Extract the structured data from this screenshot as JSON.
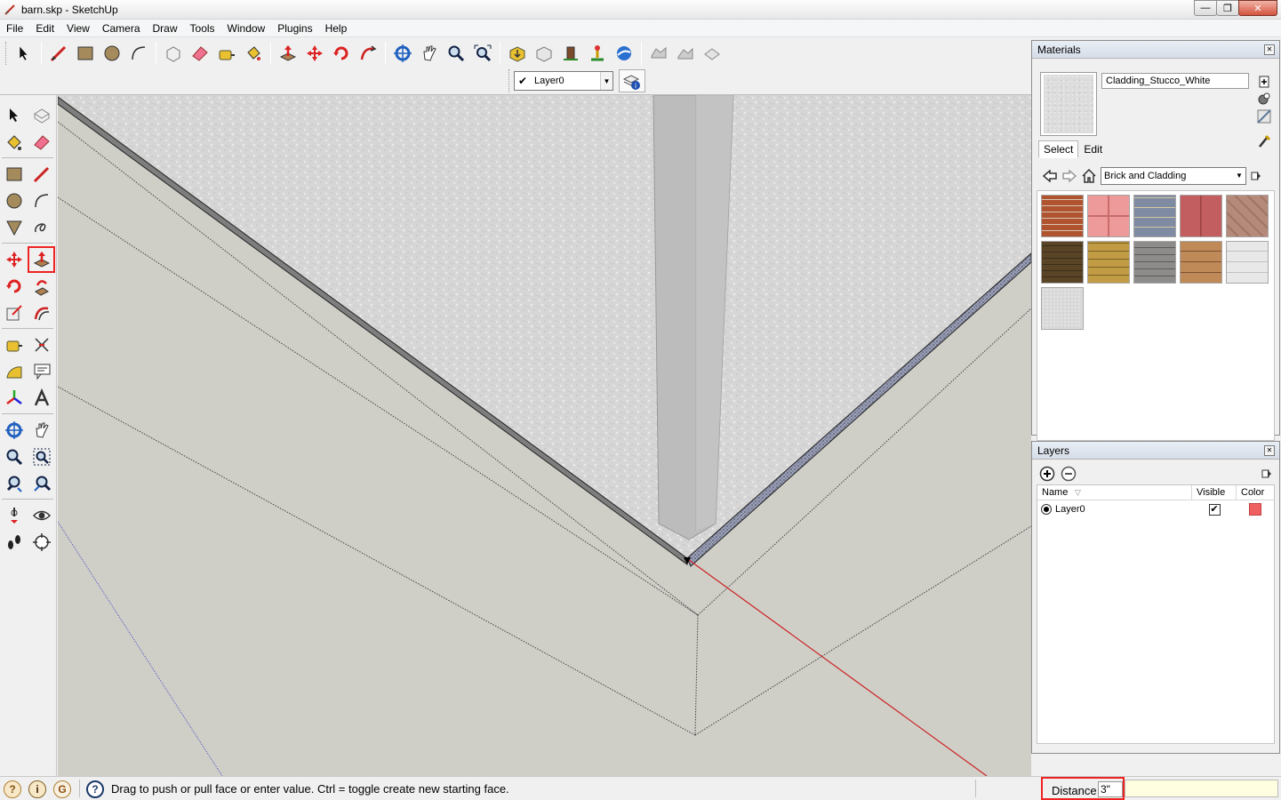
{
  "window": {
    "title": "barn.skp - SketchUp",
    "minimize": "—",
    "maximize": "❐",
    "close": "✕"
  },
  "menu": [
    "File",
    "Edit",
    "View",
    "Camera",
    "Draw",
    "Tools",
    "Window",
    "Plugins",
    "Help"
  ],
  "layer_toolbar": {
    "current_layer": "Layer0"
  },
  "materials_panel": {
    "title": "Materials",
    "material_name": "Cladding_Stucco_White",
    "tabs": [
      "Select",
      "Edit"
    ],
    "active_tab": "Select",
    "library": "Brick and Cladding",
    "swatches": [
      {
        "name": "brick-red-swatch",
        "color": "#a24a2c"
      },
      {
        "name": "brick-pink-pattern-swatch",
        "color": "#e88a8a"
      },
      {
        "name": "stone-blue-gray-swatch",
        "color": "#8690a6"
      },
      {
        "name": "brick-dark-red-swatch",
        "color": "#b9575a"
      },
      {
        "name": "stone-tan-swatch",
        "color": "#b6897a"
      },
      {
        "name": "brick-dark-swatch",
        "color": "#5a4426"
      },
      {
        "name": "stone-yellow-swatch",
        "color": "#b4923f"
      },
      {
        "name": "stone-gray-swatch",
        "color": "#8e8c8a"
      },
      {
        "name": "siding-brown-swatch",
        "color": "#b58050"
      },
      {
        "name": "siding-white-swatch",
        "color": "#e5e5e5"
      },
      {
        "name": "stucco-white-swatch",
        "color": "#dadada"
      }
    ]
  },
  "layers_panel": {
    "title": "Layers",
    "columns": {
      "name": "Name",
      "visible": "Visible",
      "color": "Color"
    },
    "rows": [
      {
        "name": "Layer0",
        "visible": true,
        "color": "#f06060"
      }
    ]
  },
  "status": {
    "message": "Drag to push or pull face or enter value.  Ctrl = toggle create new starting face.",
    "vcb_label": "Distance",
    "vcb_value": "3\""
  },
  "colors": {
    "axis_red": "#cc2020",
    "axis_blue": "#4040c0",
    "viewport_bg": "#cfcfc9",
    "active_tool_outline": "#ee2222"
  }
}
